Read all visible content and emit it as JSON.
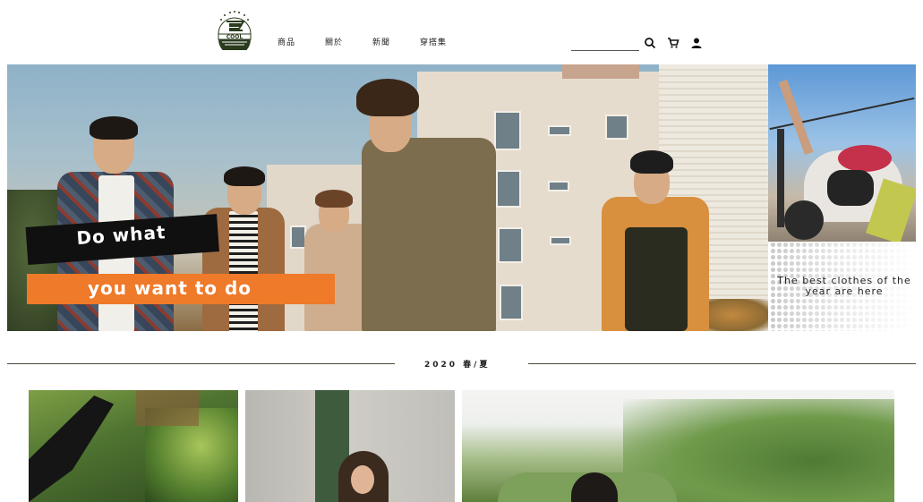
{
  "header": {
    "logo_text": "COOL",
    "nav": [
      "商品",
      "關於",
      "新聞",
      "穿搭集"
    ],
    "search": {
      "placeholder": "",
      "value": ""
    },
    "icons": [
      "search-icon",
      "cart-icon",
      "account-icon"
    ]
  },
  "hero": {
    "headline_line1": "Do what",
    "headline_line2": "you want to do",
    "colors": {
      "tag_dark": "#101010",
      "tag_accent": "#ee7a2a"
    }
  },
  "side_panel": {
    "caption": "The best clothes of the year are here"
  },
  "season": {
    "label": "2020 春/夏"
  }
}
